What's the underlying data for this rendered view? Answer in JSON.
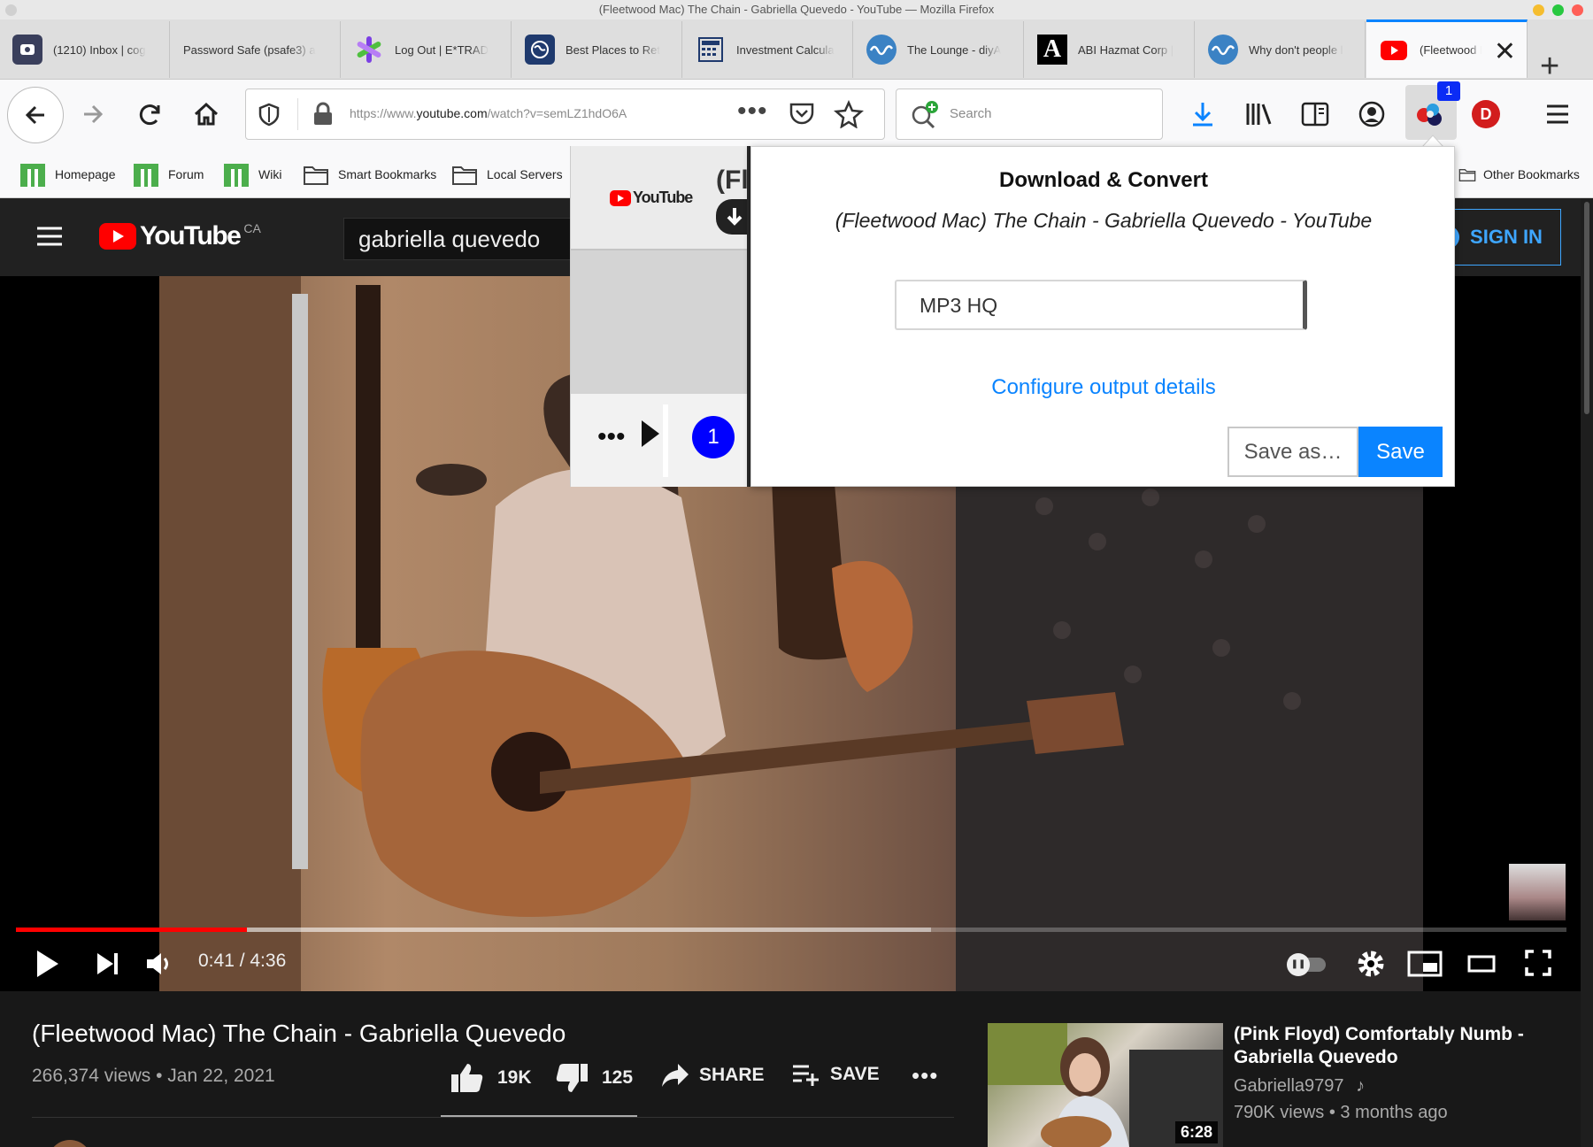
{
  "window": {
    "title": "(Fleetwood Mac) The Chain - Gabriella Quevedo - YouTube — Mozilla Firefox"
  },
  "tabs": [
    {
      "label": "(1210) Inbox | cog",
      "icon": "mail-icon",
      "color": "#3a3f5c"
    },
    {
      "label": "Password Safe (psafe3) a",
      "icon": "none",
      "color": ""
    },
    {
      "label": "Log Out | E*TRAD",
      "icon": "etrade-icon",
      "color": "#7b3fe4"
    },
    {
      "label": "Best Places to Ret",
      "icon": "globe-icon",
      "color": "#1f3a6e"
    },
    {
      "label": "Investment Calcula",
      "icon": "calculator-icon",
      "color": "#1f3a6e"
    },
    {
      "label": "The Lounge - diyA",
      "icon": "wave-icon",
      "color": "#3b82c4"
    },
    {
      "label": "ABI Hazmat Corp |",
      "icon": "letter-a-icon",
      "color": "#000000"
    },
    {
      "label": "Why don't people l",
      "icon": "wave-icon",
      "color": "#3b82c4"
    },
    {
      "label": "(Fleetwood M",
      "icon": "youtube-icon",
      "color": "#ff0000"
    }
  ],
  "nav": {
    "url_prefix": "https://www.",
    "url_host": "youtube.com",
    "url_path": "/watch?v=semLZ1hdO6A",
    "search_placeholder": "Search",
    "ext_badge": "1",
    "profile_letter": "D"
  },
  "bookmarks": [
    {
      "label": "Homepage",
      "icon": "green-bars-icon"
    },
    {
      "label": "Forum",
      "icon": "green-bars-icon"
    },
    {
      "label": "Wiki",
      "icon": "green-bars-icon"
    },
    {
      "label": "Smart Bookmarks",
      "icon": "folder-icon"
    },
    {
      "label": "Local Servers",
      "icon": "folder-icon"
    },
    {
      "label": "Other Bookmarks",
      "icon": "folder-icon"
    }
  ],
  "youtube": {
    "logo_text": "YouTube",
    "region": "CA",
    "search_value": "gabriella quevedo",
    "signin": "SIGN IN",
    "time": "0:41 / 4:36",
    "progress": 0.149,
    "buffered": 0.59,
    "video_title": "(Fleetwood Mac) The Chain - Gabriella Quevedo",
    "views": "266,374 views • Jan 22, 2021",
    "likes": "19K",
    "dislikes": "125",
    "share": "SHARE",
    "save": "SAVE",
    "related": {
      "title": "(Pink Floyd) Comfortably Numb - Gabriella Quevedo",
      "channel": "Gabriella9797",
      "meta": "790K views • 3 months ago",
      "duration": "6:28"
    }
  },
  "extension": {
    "left_label": "(Fl",
    "left_logo": "YouTube",
    "left_badge": "1",
    "title": "Download & Convert",
    "subtitle": "(Fleetwood Mac) The Chain - Gabriella Quevedo - YouTube",
    "format": "MP3 HQ",
    "configure": "Configure output details",
    "save_as": "Save as…",
    "save": "Save"
  }
}
